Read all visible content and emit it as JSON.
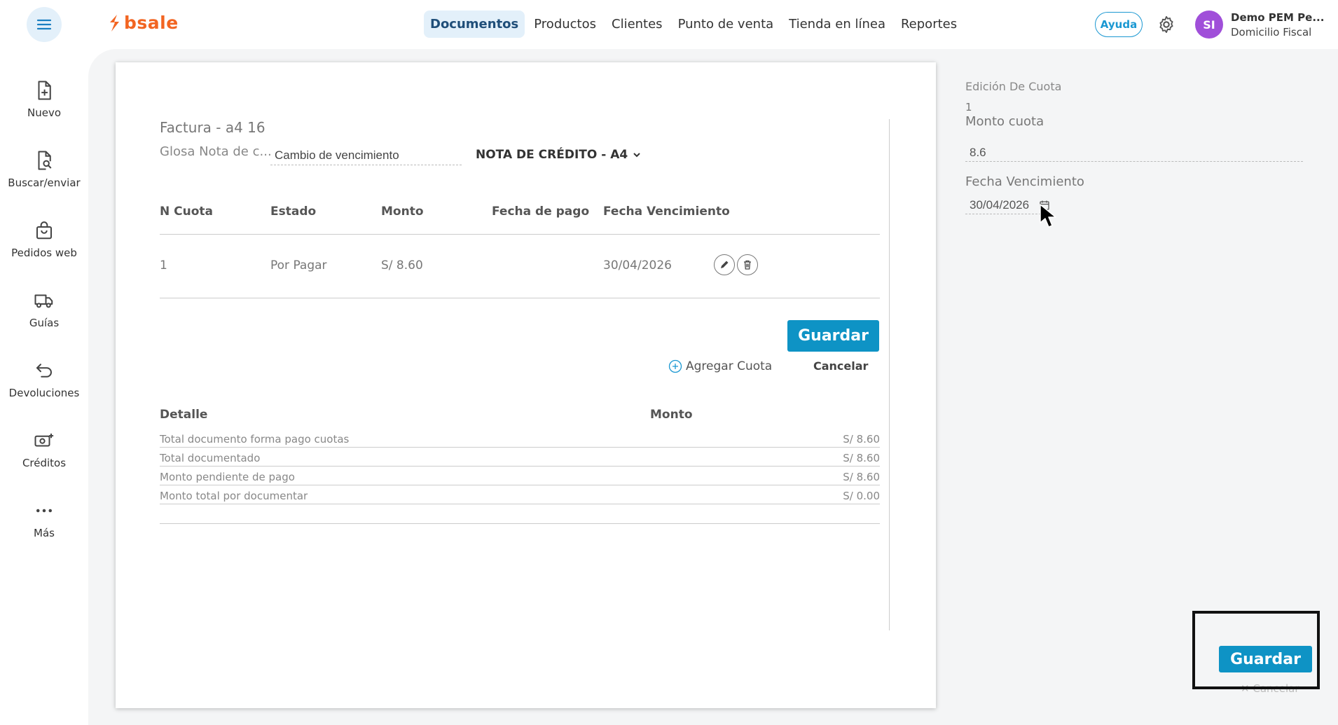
{
  "header": {
    "logo_text": "bsale",
    "nav": [
      {
        "label": "Documentos",
        "active": true
      },
      {
        "label": "Productos"
      },
      {
        "label": "Clientes"
      },
      {
        "label": "Punto de venta"
      },
      {
        "label": "Tienda en línea"
      },
      {
        "label": "Reportes"
      }
    ],
    "help_label": "Ayuda",
    "avatar_initials": "SI",
    "user_name": "Demo PEM Pe...",
    "user_sub": "Domicilio Fiscal"
  },
  "sidebar": {
    "items": [
      {
        "label": "Nuevo",
        "icon": "file-plus-icon"
      },
      {
        "label": "Buscar/enviar",
        "icon": "file-search-icon"
      },
      {
        "label": "Pedidos web",
        "icon": "shopping-bag-icon"
      },
      {
        "label": "Guías",
        "icon": "truck-icon"
      },
      {
        "label": "Devoluciones",
        "icon": "return-arrow-icon"
      },
      {
        "label": "Créditos",
        "icon": "credit-money-icon"
      },
      {
        "label": "Más",
        "icon": "more-dots-icon"
      }
    ]
  },
  "document": {
    "title": "Factura - a4 16",
    "glosa_label": "Glosa Nota de c...",
    "glosa_value": "Cambio de vencimiento",
    "doc_type": "NOTA DE CRÉDITO - A4",
    "table": {
      "headers": [
        "N Cuota",
        "Estado",
        "Monto",
        "Fecha de pago",
        "Fecha Vencimiento"
      ],
      "rows": [
        {
          "n": "1",
          "estado": "Por Pagar",
          "monto": "S/ 8.60",
          "fecha_pago": "",
          "fecha_venc": "30/04/2026"
        }
      ]
    },
    "save_label": "Guardar",
    "add_cuota_label": "Agregar Cuota",
    "cancel_label": "Cancelar",
    "detail": {
      "header_left": "Detalle",
      "header_right": "Monto",
      "rows": [
        {
          "label": "Total documento forma pago cuotas",
          "value": "S/ 8.60"
        },
        {
          "label": "Total documentado",
          "value": "S/ 8.60"
        },
        {
          "label": "Monto pendiente de pago",
          "value": "S/ 8.60"
        },
        {
          "label": "Monto total por documentar",
          "value": "S/ 0.00"
        }
      ]
    }
  },
  "edit_panel": {
    "title": "Edición De Cuota",
    "cuota_number": "1",
    "monto_label": "Monto cuota",
    "monto_value": "8.6",
    "fecha_label": "Fecha Vencimiento",
    "fecha_value": "30/04/2026",
    "save_label": "Guardar",
    "cancel_label": "Cancelar"
  },
  "colors": {
    "brand_orange": "#f26522",
    "primary_blue": "#0e93c5",
    "avatar_purple": "#a04fd9"
  }
}
